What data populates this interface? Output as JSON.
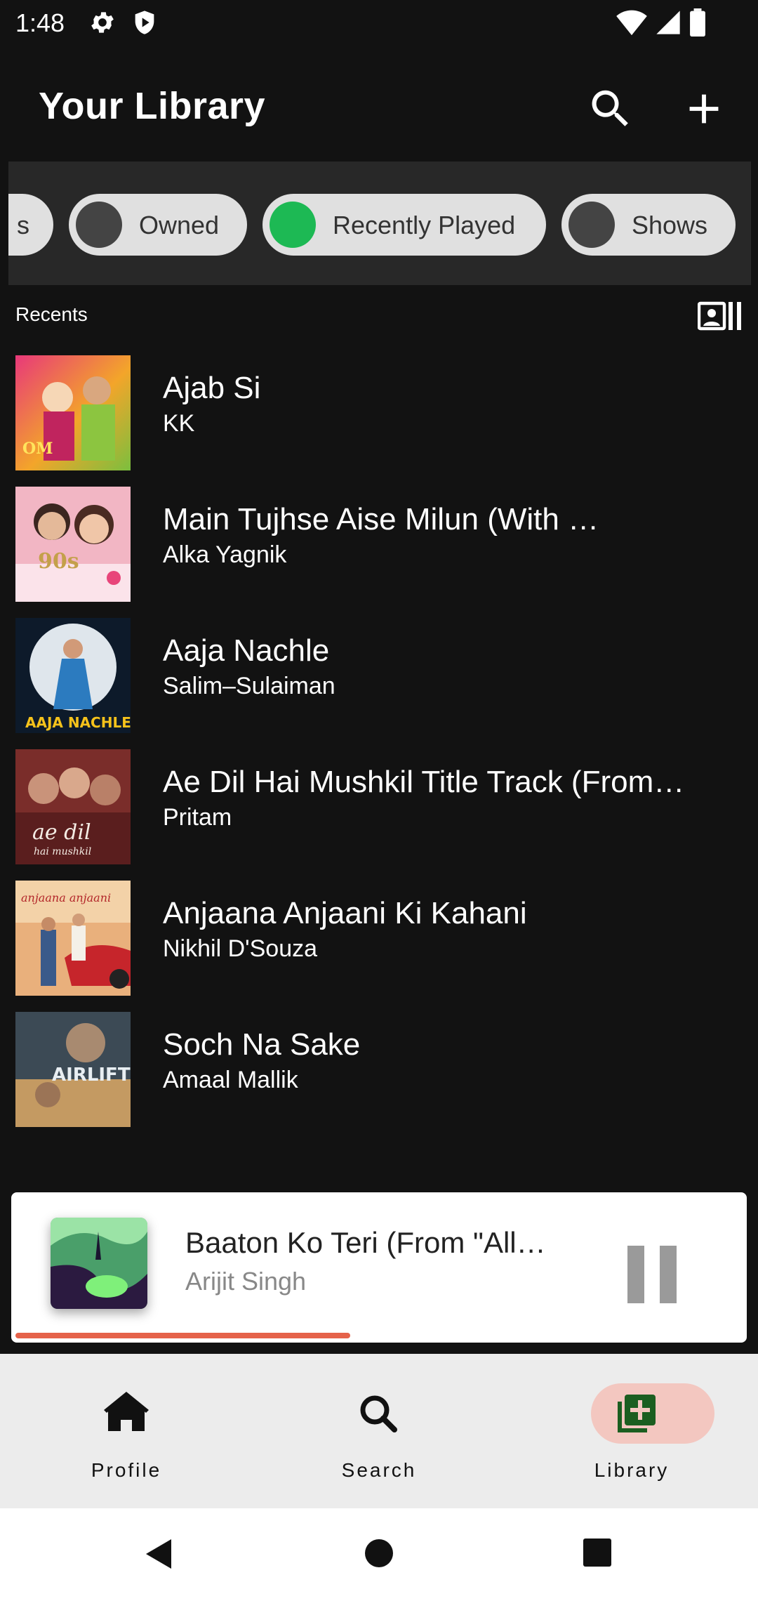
{
  "status_bar": {
    "time": "1:48",
    "icons": [
      "settings-icon",
      "shield-icon",
      "wifi-icon",
      "cellular-icon",
      "battery-icon"
    ]
  },
  "header": {
    "title": "Your Library",
    "search_icon": "search-icon",
    "add_icon": "add-icon"
  },
  "filters": [
    {
      "label": "s",
      "selected": false
    },
    {
      "label": "Owned",
      "selected": false
    },
    {
      "label": "Recently Played",
      "selected": true
    },
    {
      "label": "Shows",
      "selected": false
    }
  ],
  "recents_label": "Recents",
  "grid_toggle_icon": "grid-view-icon",
  "tracks": [
    {
      "title": "Ajab Si",
      "artist": "KK"
    },
    {
      "title": "Main Tujhse Aise Milun (With …",
      "artist": "Alka Yagnik"
    },
    {
      "title": "Aaja Nachle",
      "artist": "Salim–Sulaiman"
    },
    {
      "title": "Ae Dil Hai Mushkil Title Track (From…",
      "artist": "Pritam"
    },
    {
      "title": "Anjaana Anjaani Ki Kahani",
      "artist": "Nikhil D'Souza"
    },
    {
      "title": "Soch Na Sake",
      "artist": "Amaal Mallik"
    }
  ],
  "now_playing": {
    "title": "Baaton Ko Teri (From \"All…",
    "artist": "Arijit Singh",
    "progress": 0.46,
    "state": "playing"
  },
  "bottom_nav": [
    {
      "label": "Profile",
      "icon": "home-icon",
      "active": false
    },
    {
      "label": "Search",
      "icon": "search-icon",
      "active": false
    },
    {
      "label": "Library",
      "icon": "library-add-icon",
      "active": true
    }
  ],
  "colors": {
    "accent": "#1db954",
    "background": "#121212",
    "progress": "#e5624a",
    "active_pill": "#f3c7c0"
  }
}
